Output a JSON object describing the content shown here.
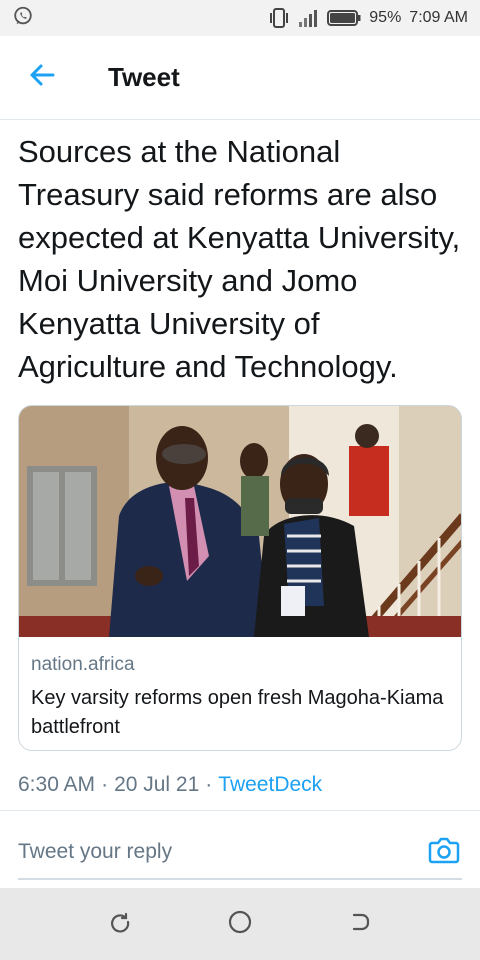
{
  "status_bar": {
    "battery_percent": "95%",
    "time": "7:09 AM",
    "icons": [
      "whatsapp-icon",
      "vibrate-icon",
      "signal-icon",
      "battery-icon"
    ]
  },
  "header": {
    "title": "Tweet",
    "back_icon": "arrow-left-icon"
  },
  "tweet": {
    "text": "Sources at the National Treasury said reforms are also expected at Kenyatta University, Moi University and Jomo Kenyatta University of Agriculture and Technology.",
    "card": {
      "domain": "nation.africa",
      "title": "Key varsity reforms open fresh Magoha-Kiama battlefront"
    },
    "time": "6:30 AM",
    "date": "20 Jul 21",
    "separator": "·",
    "source": "TweetDeck"
  },
  "reply": {
    "placeholder": "Tweet your reply",
    "camera_icon": "camera-icon"
  },
  "nav": {
    "icons": [
      "recents-icon",
      "home-circle-icon",
      "back-nav-icon"
    ]
  },
  "colors": {
    "accent": "#1da1f2",
    "secondary_text": "#657786",
    "primary_text": "#14171a",
    "divider": "#e1e8ed"
  }
}
